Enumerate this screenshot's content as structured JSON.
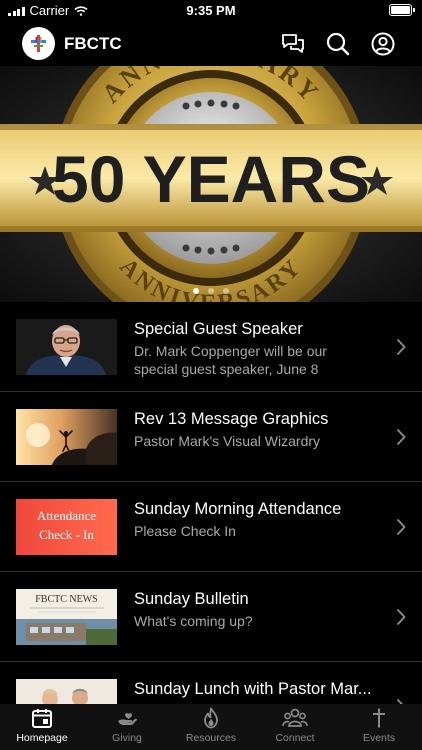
{
  "status_bar": {
    "carrier": "Carrier",
    "time": "9:35 PM"
  },
  "header": {
    "title": "FBCTC",
    "icons": [
      "chat-icon",
      "search-icon",
      "profile-icon"
    ]
  },
  "hero": {
    "main_text": "50 YEARS",
    "arc_text_top": "ANNIVERSARY",
    "arc_text_bottom": "ANNIVERSARY",
    "slide_count": 3,
    "active_slide": 1
  },
  "list": {
    "items": [
      {
        "title": "Special Guest Speaker",
        "subtitle": "Dr. Mark Coppenger will be our special guest speaker, June 8",
        "thumb": "portrait"
      },
      {
        "title": "Rev 13 Message Graphics",
        "subtitle": "Pastor Mark's Visual Wizardry",
        "thumb": "sunset"
      },
      {
        "title": "Sunday Morning Attendance",
        "subtitle": "Please Check In",
        "thumb": "attendance",
        "thumb_text_1": "Attendance",
        "thumb_text_2": "Check - In"
      },
      {
        "title": "Sunday Bulletin",
        "subtitle": "What's coming up?",
        "thumb": "bulletin",
        "thumb_text": "FBCTC NEWS"
      },
      {
        "title": "Sunday Lunch with Pastor Mar...",
        "subtitle": "",
        "thumb": "people"
      }
    ]
  },
  "tabs": [
    {
      "label": "Homepage",
      "icon": "calendar-icon",
      "active": true
    },
    {
      "label": "Giving",
      "icon": "giving-hand-icon",
      "active": false
    },
    {
      "label": "Resources",
      "icon": "flame-icon",
      "active": false
    },
    {
      "label": "Connect",
      "icon": "people-icon",
      "active": false
    },
    {
      "label": "Events",
      "icon": "cross-icon",
      "active": false
    }
  ],
  "colors": {
    "background": "#000000",
    "accent_gold": "#c9a43e",
    "subtitle_gray": "#a9a9a9",
    "attendance_red": "#f0483c"
  }
}
